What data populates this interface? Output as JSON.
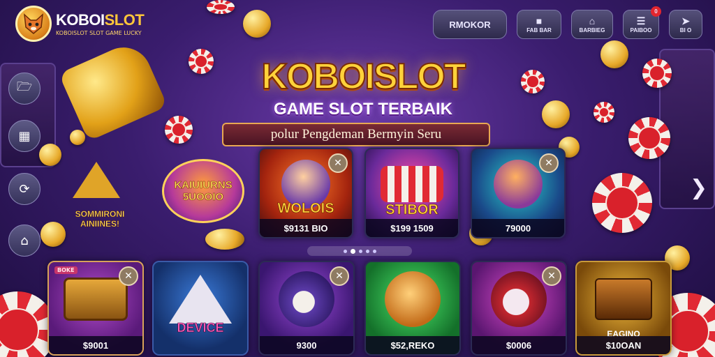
{
  "brand": {
    "name_part1": "KOBOI",
    "name_part2": "SLOT",
    "tagline": "KOBOISLOT SLOT GAME LUCKY"
  },
  "topnav": {
    "primary_button": "RMOKOR",
    "items": [
      {
        "label": "FAB BAR",
        "icon": "garage-icon"
      },
      {
        "label": "BARBIEG",
        "icon": "house-icon"
      },
      {
        "label": "PAIBOO",
        "icon": "list-icon",
        "badge": "0"
      },
      {
        "label": "BI O",
        "icon": "share-icon"
      }
    ]
  },
  "sidenav": {
    "items": [
      {
        "icon": "folder-icon"
      },
      {
        "icon": "card-icon"
      },
      {
        "icon": "refresh-icon"
      },
      {
        "icon": "home-icon"
      }
    ]
  },
  "hero": {
    "title": "KOBOISLOT",
    "subtitle": "GAME SLOT TERBAIK",
    "banner": "polur Pengdeman Bermyin Seru"
  },
  "promos": {
    "circle_text": "KAIUIURNS 5UOOIO",
    "left_text": "SOMMIRONI AINIINES!"
  },
  "featured_games": [
    {
      "title": "WOLOIS",
      "price": "$9131 BIO",
      "has_close": true
    },
    {
      "title": "STIBOR",
      "price": "$199 1509",
      "has_close": false
    },
    {
      "title": "",
      "price": "79000",
      "has_close": true
    }
  ],
  "games": [
    {
      "title": "",
      "price": "$9001",
      "has_close": true,
      "tag": "BOKE"
    },
    {
      "title": "DEVICE",
      "price": "",
      "has_close": false
    },
    {
      "title": "",
      "price": "9300",
      "has_close": true
    },
    {
      "title": "",
      "price": "$52,REKO",
      "has_close": false
    },
    {
      "title": "",
      "price": "$0006",
      "has_close": true
    },
    {
      "title": "EAGINO",
      "price": "$10OAN",
      "has_close": false
    }
  ],
  "colors": {
    "accent_gold": "#ffd23a",
    "background": "#3a1d6e",
    "chip_red": "#e12a34"
  }
}
